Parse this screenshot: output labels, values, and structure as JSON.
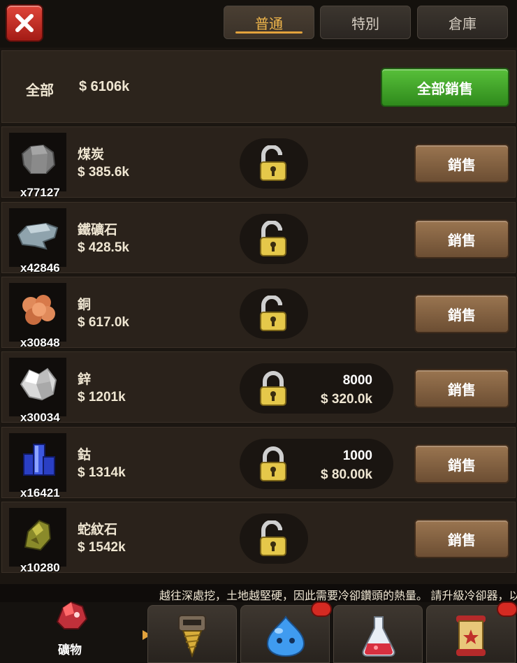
{
  "header": {
    "close_icon": "close-x-icon",
    "tabs": [
      {
        "label": "普通",
        "active": true
      },
      {
        "label": "特別",
        "active": false
      },
      {
        "label": "倉庫",
        "active": false
      }
    ]
  },
  "summary": {
    "label": "全部",
    "value": "$ 6106k",
    "sell_all_label": "全部銷售"
  },
  "items": [
    {
      "name": "煤炭",
      "price": "$ 385.6k",
      "count": "x77127",
      "icon": "coal-icon",
      "lock": "unlocked-padlock-icon",
      "sell_label": "銷售"
    },
    {
      "name": "鐵礦石",
      "price": "$ 428.5k",
      "count": "x42846",
      "icon": "iron-ore-icon",
      "lock": "unlocked-padlock-icon",
      "sell_label": "銷售"
    },
    {
      "name": "銅",
      "price": "$ 617.0k",
      "count": "x30848",
      "icon": "copper-icon",
      "lock": "unlocked-padlock-icon",
      "sell_label": "銷售"
    },
    {
      "name": "鋅",
      "price": "$ 1201k",
      "count": "x30034",
      "icon": "zinc-icon",
      "lock": "locked-padlock-icon",
      "lock_qty": "8000",
      "lock_value": "$ 320.0k",
      "sell_label": "銷售"
    },
    {
      "name": "鈷",
      "price": "$ 1314k",
      "count": "x16421",
      "icon": "cobalt-icon",
      "lock": "locked-padlock-icon",
      "lock_qty": "1000",
      "lock_value": "$ 80.00k",
      "sell_label": "銷售"
    },
    {
      "name": "蛇紋石",
      "price": "$ 1542k",
      "count": "x10280",
      "icon": "serpentine-icon",
      "lock": "unlocked-padlock-icon",
      "sell_label": "銷售"
    }
  ],
  "ticker": {
    "text": "越往深處挖，土地越堅硬，因此需要冷卻鑽頭的熱量。 請升級冷卻器，以"
  },
  "bottom_nav": {
    "active_label": "礦物",
    "tabs": [
      {
        "icon": "minerals-icon",
        "label": "礦物"
      },
      {
        "icon": "drill-icon"
      },
      {
        "icon": "slime-icon",
        "badge": true
      },
      {
        "icon": "potion-flask-icon"
      },
      {
        "icon": "scroll-banner-icon",
        "badge": true
      }
    ]
  },
  "colors": {
    "accent_tab": "#e2a23c",
    "sell_all_green": "#3fa52a",
    "sell_brown": "#8a6645",
    "close_red": "#c9302a"
  }
}
